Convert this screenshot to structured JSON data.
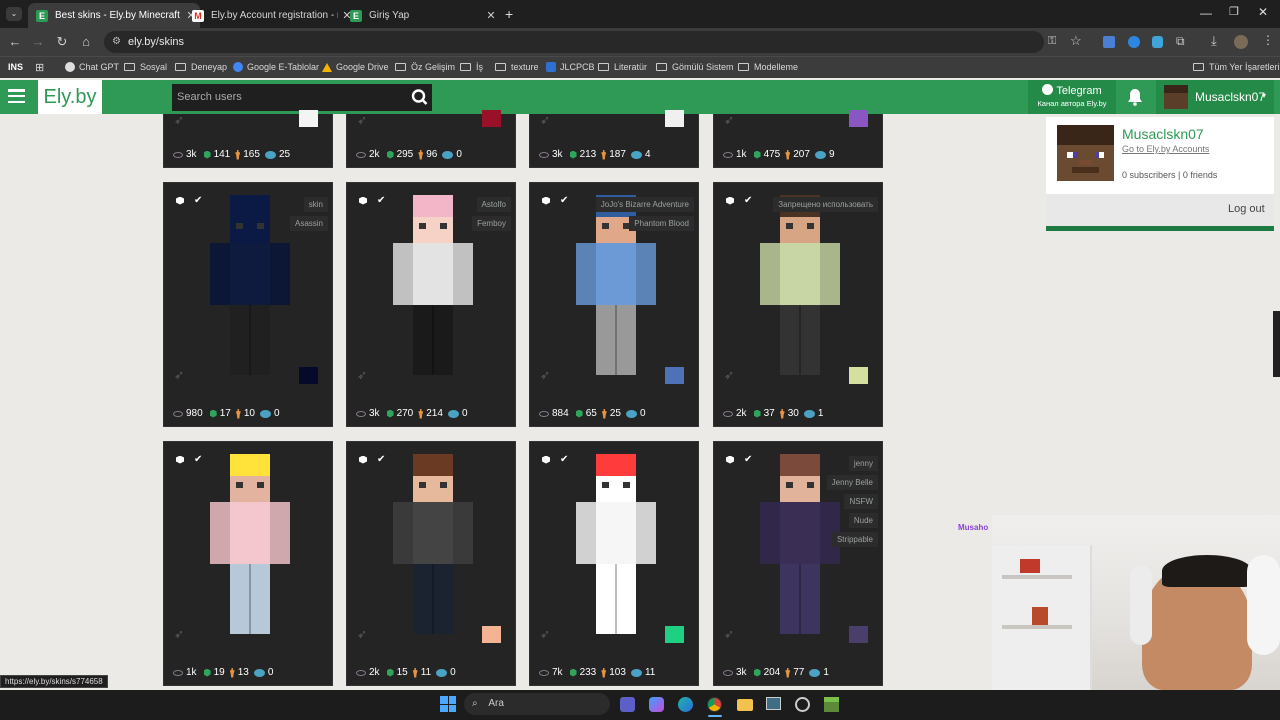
{
  "browser": {
    "tabs": [
      {
        "title": "Best skins - Ely.by Minecraft Sk",
        "fav": "E",
        "active": true
      },
      {
        "title": "Ely.by Account registration - m",
        "fav": "M",
        "active": false
      },
      {
        "title": "Giriş Yap",
        "fav": "E",
        "active": false
      }
    ],
    "url": "ely.by/skins",
    "bookmarks": [
      "INS",
      "Chat GPT",
      "Sosyal",
      "Deneyap",
      "Google E-Tablolar",
      "Google Drive",
      "Öz Gelişim",
      "İş",
      "texture",
      "JLCPCB",
      "Literatür",
      "Gömülü Sistem",
      "Modelleme",
      "Tüm Yer İşaretleri"
    ],
    "status_url": "https://ely.by/skins/s774658"
  },
  "header": {
    "logo": "Ely.by",
    "search_placeholder": "Search users",
    "telegram_title": "Telegram",
    "telegram_sub": "Канал автора Ely.by",
    "username": "Musaclskn07"
  },
  "profile": {
    "name": "Musaclskn07",
    "accounts_link": "Go to Ely.by Accounts",
    "stats": "0 subscribers | 0 friends",
    "logout": "Log out"
  },
  "top_row": [
    {
      "views": "3k",
      "likes": "141",
      "downloads": "165",
      "comments": "25",
      "swatch": "#f4f4f4"
    },
    {
      "views": "2k",
      "likes": "295",
      "downloads": "96",
      "comments": "0",
      "swatch": "#9a1028"
    },
    {
      "views": "3k",
      "likes": "213",
      "downloads": "187",
      "comments": "4",
      "swatch": "#f0f0f0"
    },
    {
      "views": "1k",
      "likes": "475",
      "downloads": "207",
      "comments": "9",
      "swatch": "#8a56c2"
    }
  ],
  "cards": [
    {
      "tags": [
        "skin",
        "Asassin"
      ],
      "views": "980",
      "likes": "17",
      "downloads": "10",
      "comments": "0",
      "swatch": "#060a2a"
    },
    {
      "tags": [
        "Astolfo",
        "Femboy"
      ],
      "views": "3k",
      "likes": "270",
      "downloads": "214",
      "comments": "0",
      "swatch": "#242424"
    },
    {
      "tags": [
        "JoJo's Bizarre Adventure",
        "Phantom Blood"
      ],
      "views": "884",
      "likes": "65",
      "downloads": "25",
      "comments": "0",
      "swatch": "#4d72b6"
    },
    {
      "tags": [
        "Запрещено использовать"
      ],
      "views": "2k",
      "likes": "37",
      "downloads": "30",
      "comments": "1",
      "swatch": "#d5df9f"
    },
    {
      "tags": [],
      "views": "1k",
      "likes": "19",
      "downloads": "13",
      "comments": "0",
      "swatch": "#242424"
    },
    {
      "tags": [],
      "views": "2k",
      "likes": "15",
      "downloads": "11",
      "comments": "0",
      "swatch": "#f4b392"
    },
    {
      "tags": [],
      "views": "7k",
      "likes": "233",
      "downloads": "103",
      "comments": "11",
      "swatch": "#1fcf82"
    },
    {
      "tags": [
        "jenny",
        "Jenny Belle",
        "NSFW",
        "Nude",
        "Strippable"
      ],
      "views": "3k",
      "likes": "204",
      "downloads": "77",
      "comments": "1",
      "swatch": "#4a3f6a"
    }
  ],
  "overlay_name": "Musaho",
  "taskbar": {
    "search": "Ara"
  }
}
